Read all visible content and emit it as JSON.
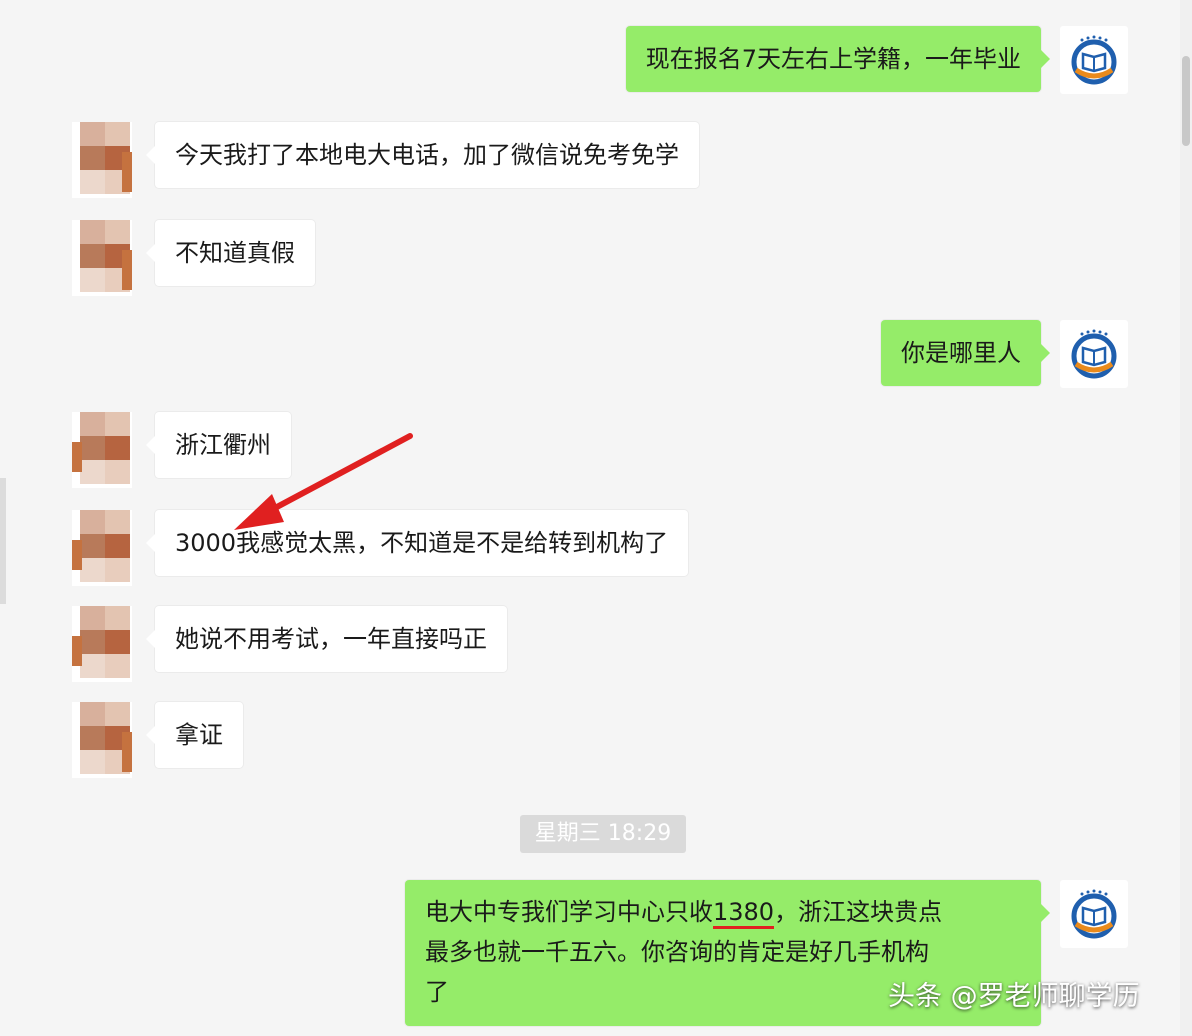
{
  "messages": [
    {
      "side": "right",
      "text": "现在报名7天左右上学籍，一年毕业"
    },
    {
      "side": "left",
      "text": "今天我打了本地电大电话，加了微信说免考免学"
    },
    {
      "side": "left",
      "text": "不知道真假"
    },
    {
      "side": "right",
      "text": "你是哪里人"
    },
    {
      "side": "left",
      "text": "浙江衢州"
    },
    {
      "side": "left",
      "text": "3000我感觉太黑，不知道是不是给转到机构了"
    },
    {
      "side": "left",
      "text": "她说不用考试，一年直接吗正"
    },
    {
      "side": "left",
      "text": "拿证"
    }
  ],
  "timestamp": "星期三 18:29",
  "last_message": {
    "line1_before": "电大中专我们学习中心只收",
    "line1_highlight": "1380",
    "line1_after": "，浙江这块贵点",
    "line2": "最多也就一千五六。你咨询的肯定是好几手机构",
    "line3": "了"
  },
  "watermark": "头条 @罗老师聊学历",
  "colors": {
    "sent_bubble": "#95ec69",
    "received_bubble": "#ffffff",
    "background": "#f5f5f5",
    "annotation_arrow": "#e02020"
  },
  "icons": {
    "self_avatar": "school-book-logo-icon",
    "contact_avatar": "pixelated-avatar-icon"
  }
}
